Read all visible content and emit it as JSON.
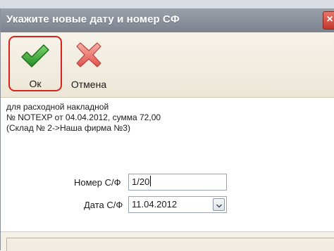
{
  "window": {
    "title": "Укажите новые дату и номер СФ",
    "close_glyph": "×"
  },
  "toolbar": {
    "ok_label": "Ок",
    "ok_icon": "checkmark-icon",
    "cancel_label": "Отмена",
    "cancel_icon": "cross-icon"
  },
  "info": {
    "line1": "для расходной накладной",
    "line2": "№ NOTEXP от 04.04.2012, сумма 72,00",
    "line3": "(Склад № 2->Наша фирма №3)"
  },
  "form": {
    "number_label": "Номер С/Ф",
    "number_value": "1/20",
    "date_label": "Дата С/Ф",
    "date_value": "11.04.2012"
  },
  "colors": {
    "ok_highlight": "#d9221b",
    "check_green": "#3aa83a",
    "cancel_red": "#e0504a"
  }
}
